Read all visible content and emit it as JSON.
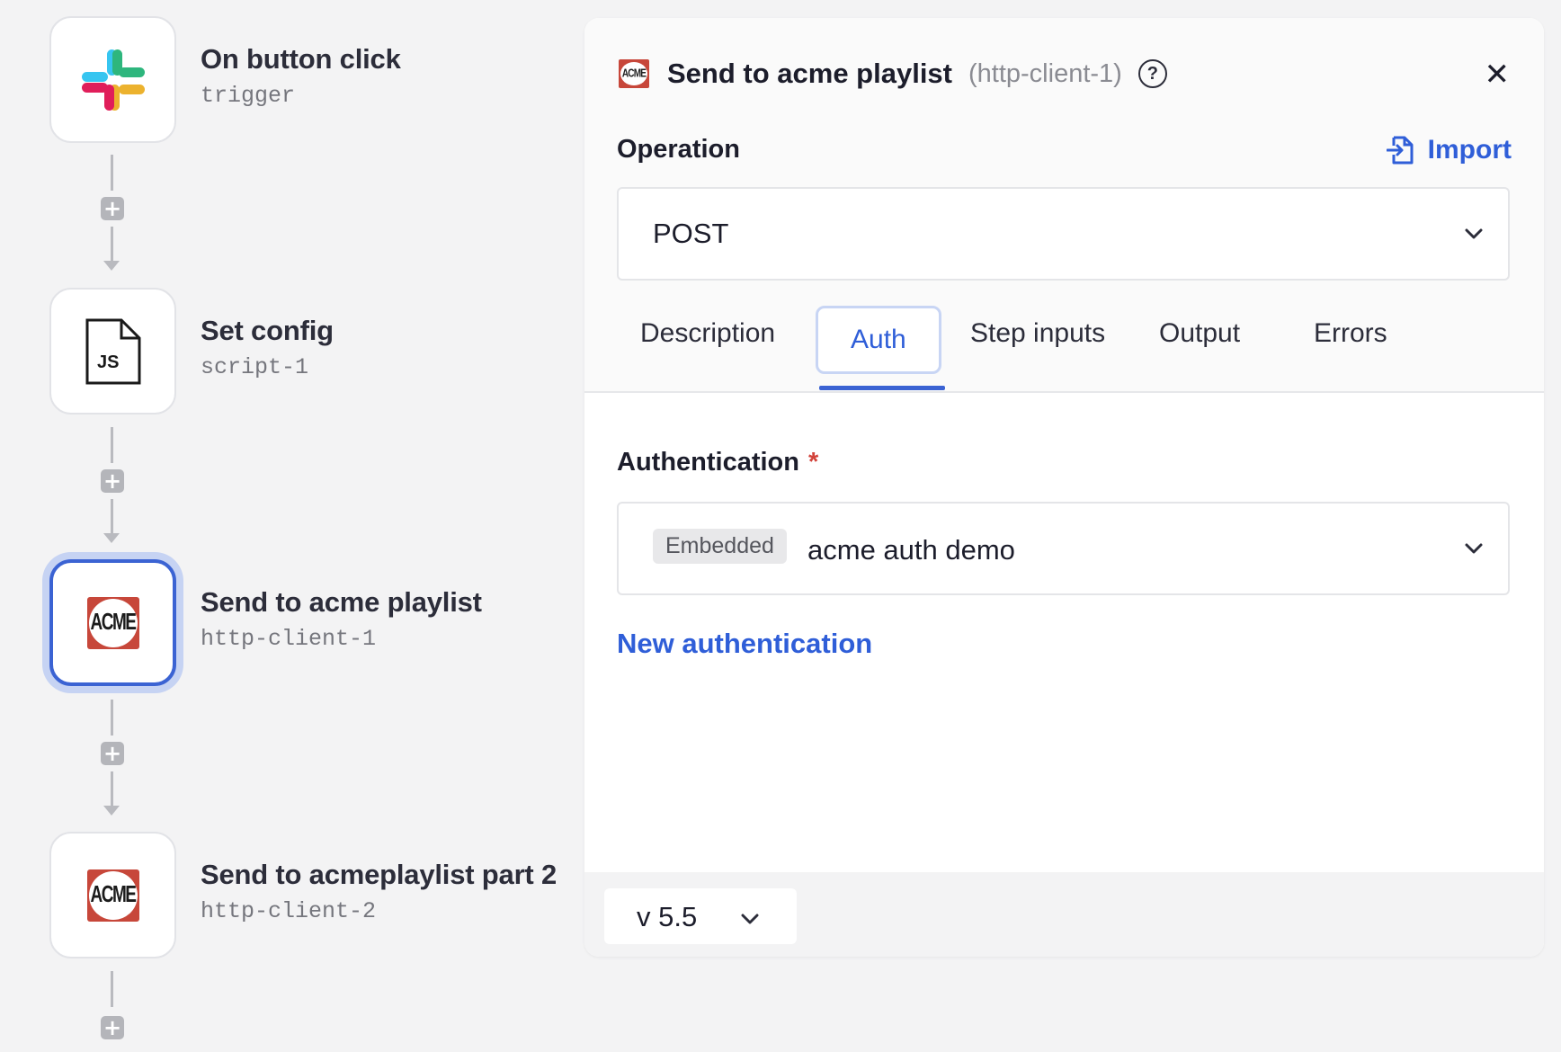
{
  "flow": {
    "steps": [
      {
        "title": "On button click",
        "subtitle": "trigger",
        "icon": "slack-icon"
      },
      {
        "title": "Set config",
        "subtitle": "script-1",
        "icon": "js-file-icon",
        "icon_text": "JS"
      },
      {
        "title": "Send to acme playlist",
        "subtitle": "http-client-1",
        "icon": "acme-logo-icon",
        "logo_text": "ACME",
        "selected": true
      },
      {
        "title": "Send to acmeplaylist part 2",
        "subtitle": "http-client-2",
        "icon": "acme-logo-icon",
        "logo_text": "ACME"
      }
    ],
    "add_symbol": "+"
  },
  "panel": {
    "logo_text": "ACME",
    "title": "Send to acme playlist",
    "id_label": "(http-client-1)",
    "help_symbol": "?",
    "close_symbol": "✕",
    "operation_label": "Operation",
    "import_label": "Import",
    "operation_value": "POST",
    "tabs": [
      "Description",
      "Auth",
      "Step inputs",
      "Output",
      "Errors"
    ],
    "active_tab": "Auth",
    "auth_label": "Authentication",
    "required_mark": "*",
    "auth_badge": "Embedded",
    "auth_value": "acme auth demo",
    "new_auth_label": "New authentication",
    "version": "v 5.5"
  },
  "colors": {
    "accent": "#3b63d3",
    "link": "#2f5ed8",
    "acme_red": "#c7473a",
    "required": "#d2423a",
    "background": "#f3f3f4"
  }
}
